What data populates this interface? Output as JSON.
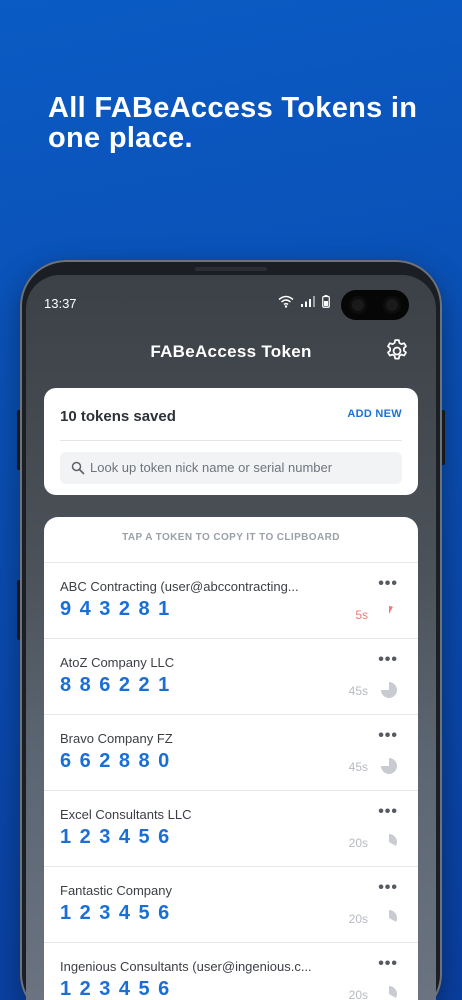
{
  "promo": {
    "headline": "All FABeAccess Tokens in one place."
  },
  "status_bar": {
    "time": "13:37"
  },
  "app": {
    "title": "FABeAccess Token"
  },
  "summary": {
    "count_label": "10 tokens saved",
    "add_new_label": "ADD NEW"
  },
  "search": {
    "placeholder": "Look up token nick name or serial number"
  },
  "list": {
    "hint": "TAP A TOKEN TO COPY IT TO CLIPBOARD",
    "menu_glyph": "•••",
    "tokens": [
      {
        "name": "ABC Contracting (user@abccontracting...",
        "code": "943281",
        "timer": "5s",
        "remaining": 0.08,
        "urgent": true
      },
      {
        "name": "AtoZ Company LLC",
        "code": "886221",
        "timer": "45s",
        "remaining": 0.75,
        "urgent": false
      },
      {
        "name": "Bravo Company FZ",
        "code": "662880",
        "timer": "45s",
        "remaining": 0.75,
        "urgent": false
      },
      {
        "name": "Excel Consultants LLC",
        "code": "123456",
        "timer": "20s",
        "remaining": 0.33,
        "urgent": false
      },
      {
        "name": "Fantastic Company",
        "code": "123456",
        "timer": "20s",
        "remaining": 0.33,
        "urgent": false
      },
      {
        "name": "Ingenious Consultants (user@ingenious.c...",
        "code": "123456",
        "timer": "20s",
        "remaining": 0.33,
        "urgent": false
      }
    ]
  },
  "colors": {
    "accent": "#1a6fd6",
    "urgent": "#f07a78",
    "background": "#0a4fb4"
  }
}
